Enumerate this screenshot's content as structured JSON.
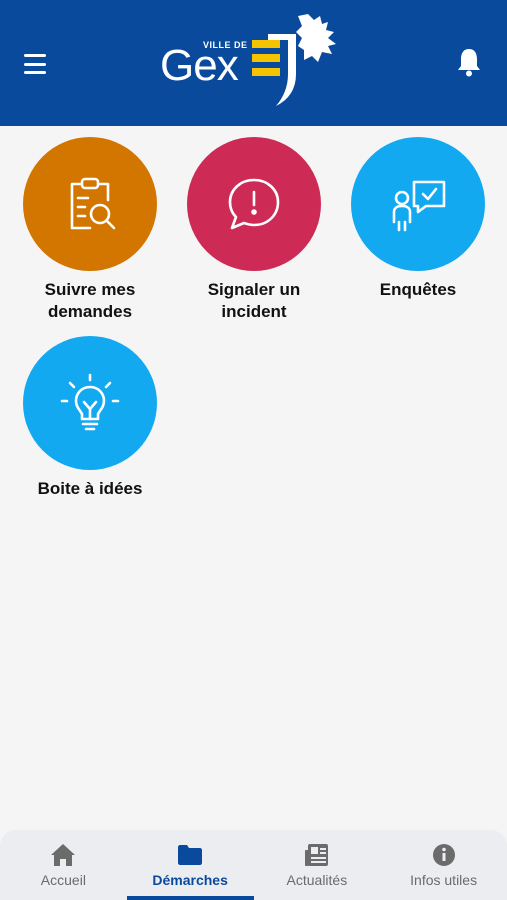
{
  "header": {
    "logo_ville": "VILLE DE",
    "logo_name": "Gex",
    "menu_icon": "hamburger-menu-icon",
    "bell_icon": "bell-icon",
    "colors": {
      "background": "#0a4a9c",
      "logo_stripes": "#f5c400"
    }
  },
  "tiles": [
    {
      "label": "Suivre mes\ndemandes",
      "icon": "clipboard-search-icon",
      "color": "#d27600"
    },
    {
      "label": "Signaler un\nincident",
      "icon": "exclamation-speech-bubble-icon",
      "color": "#cd2b55"
    },
    {
      "label": "Enquêtes",
      "icon": "person-check-bubble-icon",
      "color": "#12a9f0"
    },
    {
      "label": "Boite à idées",
      "icon": "lightbulb-icon",
      "color": "#12a9f0"
    }
  ],
  "tabbar": {
    "active": "Démarches",
    "tabs": [
      {
        "label": "Accueil",
        "icon": "home-icon"
      },
      {
        "label": "Démarches",
        "icon": "folder-icon"
      },
      {
        "label": "Actualités",
        "icon": "newspaper-icon"
      },
      {
        "label": "Infos utiles",
        "icon": "info-icon"
      }
    ]
  }
}
